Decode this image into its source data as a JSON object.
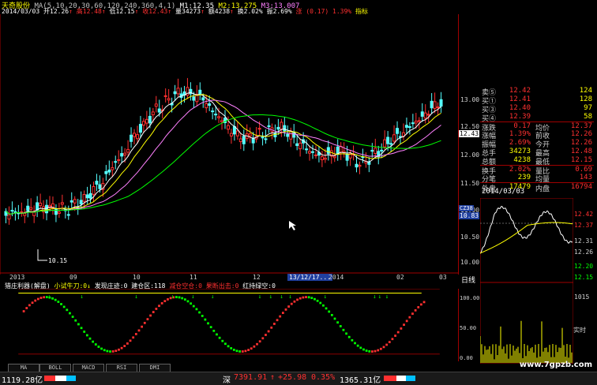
{
  "title_bar": {
    "stock_name": "天奇股份",
    "ma_label": "MA(5,10,20,30,60,120,240,360,4,1)",
    "m1": "M1:12.35",
    "m2": "M2:13.275",
    "m3": "M3:13.007"
  },
  "info_bar": {
    "date": "2014/03/03",
    "open": "开12.26",
    "open_arrow": "↑",
    "high": "高12.48",
    "high_arrow": "↑",
    "low": "低12.15",
    "low_arrow": "↑",
    "close": "收12.43",
    "close_arrow": "↑",
    "volume": "量34273",
    "volume_arrow": "↑",
    "amount": "额4238",
    "amount_arrow": "↑",
    "turnover": "换2.02%",
    "amplitude": "振2.69%",
    "change": "涨 (0.17) 1.39%",
    "indicator_btn": "指标"
  },
  "main_chart": {
    "price_labels": [
      "13.00",
      "12.50",
      "12.00",
      "11.50",
      "11.00",
      "10.50",
      "10.00"
    ],
    "current_price_tag": "12.43",
    "cursor_price_tag": "10.83",
    "cursor_label_top": "CZ38",
    "low_marker": "10.15",
    "x_labels": [
      "2013",
      "09",
      "10",
      "11",
      "12",
      "13/12/17...",
      "2014",
      "02",
      "03"
    ],
    "highlight_date": "13/12/17..."
  },
  "indicator": {
    "name": "猎庄利器(解盘)",
    "items": [
      {
        "label": "小试牛刀:0↓",
        "color": "#ffff00"
      },
      {
        "label": "发现庄迹:0",
        "color": "#ffffff"
      },
      {
        "label": "建仓区:118",
        "color": "#ffffff"
      },
      {
        "label": "减仓空仓:0",
        "color": "#ff3030"
      },
      {
        "label": "果断出击:0",
        "color": "#ff3030"
      },
      {
        "label": "红持绿空:0",
        "color": "#ffffff"
      }
    ],
    "scale": [
      "100.00",
      "50.00",
      "0.00"
    ]
  },
  "quote_panel": {
    "rows": [
      {
        "k1": "卖⑤",
        "v1": "12.42",
        "v2": "124"
      },
      {
        "k1": "买①",
        "v1": "12.41",
        "v2": "128"
      },
      {
        "k1": "买③",
        "v1": "12.40",
        "v2": "97"
      },
      {
        "k1": "买④",
        "v1": "12.39",
        "v2": "58"
      },
      {
        "k1": "涨跌",
        "v1": "0.17",
        "k2": "均价",
        "v2": "12.37"
      },
      {
        "k1": "涨幅",
        "v1": "1.39%",
        "k2": "前收",
        "v2": "12.26"
      },
      {
        "k1": "振幅",
        "v1": "2.69%",
        "k2": "今开",
        "v2": "12.26"
      },
      {
        "k1": "总手",
        "v1": "34273",
        "k2": "最高",
        "v2": "12.48"
      },
      {
        "k1": "总额",
        "v1": "4238",
        "k2": "最低",
        "v2": "12.15"
      },
      {
        "k1": "换手",
        "v1": "2.02%",
        "k2": "量比",
        "v2": "0.69"
      },
      {
        "k1": "分笔",
        "v1": "239",
        "k2": "均量",
        "v2": "143"
      },
      {
        "k1": "外盘",
        "v1": "17479",
        "k2": "内盘",
        "v2": "16794"
      }
    ]
  },
  "mini_chart": {
    "date": "2014/03/03",
    "price_labels": [
      "12.42",
      "12.37",
      "12.31",
      "12.26",
      "12.20",
      "12.15"
    ],
    "vol_labels": [
      "1015",
      "",
      "",
      "实时"
    ],
    "side_label": "日线"
  },
  "tabs": [
    "MA",
    "BOLL",
    "MACD",
    "RSI",
    "DMI"
  ],
  "status_bar": {
    "sh_index": "1119.28亿",
    "sz_label": "深",
    "sz_index": "7391.91",
    "sz_arrow": "↑",
    "sz_change": "+25.98",
    "sz_pct": "0.35%",
    "sz_amount": "1365.31亿"
  },
  "watermark": "www.7gpzb.com",
  "colors": {
    "up": "#ff3030",
    "down": "#54ffff",
    "ma5": "#ffffff",
    "ma10": "#ffff00",
    "ma20": "#ff80ff",
    "ma30": "#00ff00",
    "accent": "#ffd000"
  }
}
